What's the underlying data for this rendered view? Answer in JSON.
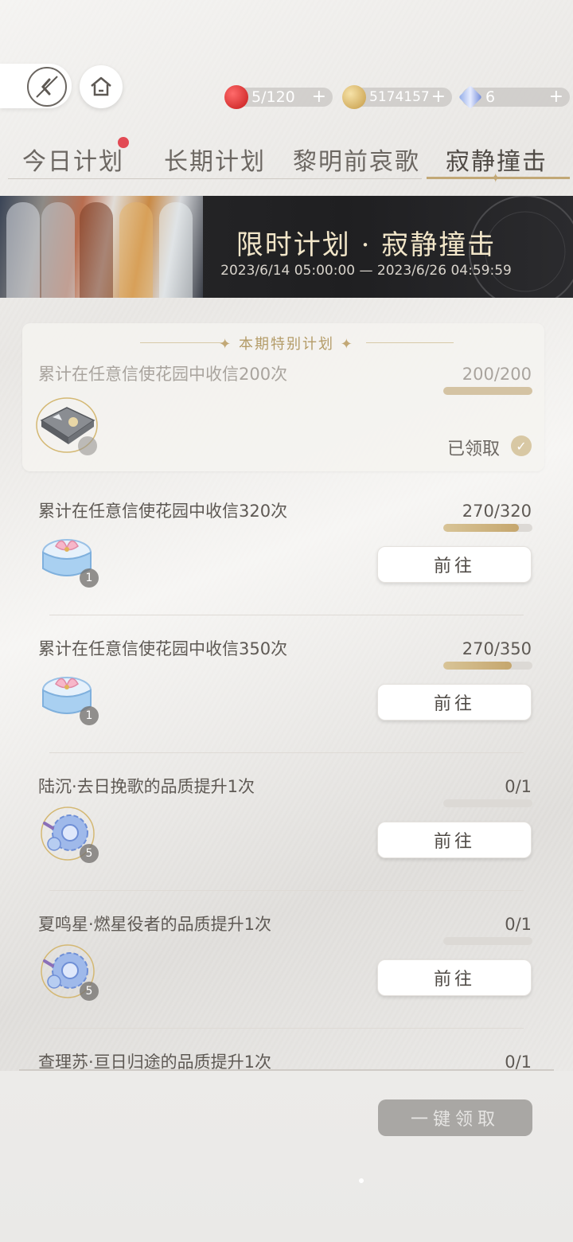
{
  "resources": {
    "stamina": "5/120",
    "gold": "5174157",
    "gems": "6",
    "plus": "+"
  },
  "tabs": [
    {
      "label": "今日计划",
      "has_dot": true
    },
    {
      "label": "长期计划"
    },
    {
      "label": "黎明前哀歌"
    },
    {
      "label": "寂静撞击",
      "active": true
    }
  ],
  "banner": {
    "title": "限时计划 · 寂静撞击",
    "date_range": "2023/6/14 05:00:00 — 2023/6/26 04:59:59"
  },
  "special": {
    "header": "本期特别计划",
    "description": "累计在任意信使花园中收信200次",
    "progress_text": "200/200",
    "progress": 1.0,
    "status": "已领取"
  },
  "tasks": [
    {
      "description": "累计在任意信使花园中收信320次",
      "progress_text": "270/320",
      "progress": 0.844,
      "reward_qty": "1",
      "reward": "gift-box",
      "button": "前往"
    },
    {
      "description": "累计在任意信使花园中收信350次",
      "progress_text": "270/350",
      "progress": 0.771,
      "reward_qty": "1",
      "reward": "gift-box",
      "button": "前往"
    },
    {
      "description": "陆沉·去日挽歌的品质提升1次",
      "progress_text": "0/1",
      "progress": 0,
      "reward_qty": "5",
      "reward": "gear",
      "button": "前往"
    },
    {
      "description": "夏鸣星·燃星役者的品质提升1次",
      "progress_text": "0/1",
      "progress": 0,
      "reward_qty": "5",
      "reward": "gear",
      "button": "前往"
    },
    {
      "description": "查理苏·亘日归途的品质提升1次",
      "progress_text": "0/1",
      "progress": 0
    }
  ],
  "claim_all": "一键领取"
}
